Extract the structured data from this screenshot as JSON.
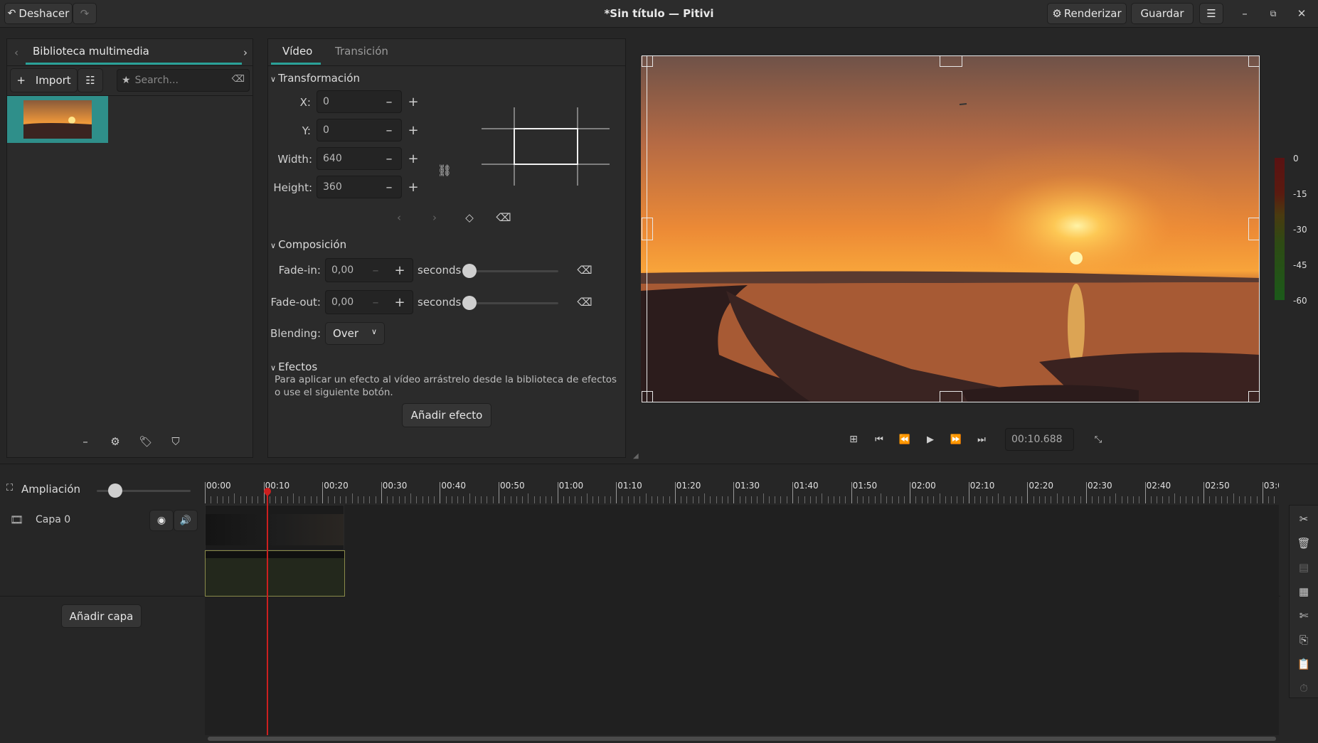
{
  "header": {
    "undo_label": "Deshacer",
    "title": "*Sin título — Pitivi",
    "render_label": "Renderizar",
    "save_label": "Guardar"
  },
  "library": {
    "tab_label": "Biblioteca multimedia",
    "import_label": "Import",
    "search_placeholder": "Search..."
  },
  "clip_props": {
    "tabs": [
      "Vídeo",
      "Transición"
    ],
    "transform": {
      "heading": "Transformación",
      "x_label": "X:",
      "x_value": "0",
      "y_label": "Y:",
      "y_value": "0",
      "width_label": "Width:",
      "width_value": "640",
      "height_label": "Height:",
      "height_value": "360"
    },
    "composition": {
      "heading": "Composición",
      "fadein_label": "Fade-in:",
      "fadein_value": "0,00",
      "fadeout_label": "Fade-out:",
      "fadeout_value": "0,00",
      "seconds_label": "seconds",
      "blending_label": "Blending:",
      "blending_value": "Over"
    },
    "effects": {
      "heading": "Efectos",
      "hint": "Para aplicar un efecto al vídeo arrástrelo desde la biblioteca de efectos o use el siguiente botón.",
      "add_label": "Añadir efecto"
    }
  },
  "viewer": {
    "timecode": "00:10.688",
    "meter_labels": [
      "0",
      "-15",
      "-30",
      "-45",
      "-60"
    ]
  },
  "timeline": {
    "zoom_label": "Ampliación",
    "layer_name": "Capa 0",
    "add_layer_label": "Añadir capa",
    "ruler_labels": [
      "00:00",
      "00:10",
      "00:20",
      "00:30",
      "00:40",
      "00:50",
      "01:00",
      "01:10",
      "01:20",
      "01:30",
      "01:40",
      "01:50",
      "02:00",
      "02:10",
      "02:20",
      "02:30",
      "02:40",
      "02:50",
      "03:0"
    ]
  },
  "colors": {
    "accent": "#2aa198",
    "playhead": "#cc1f1f",
    "thumb_bg": "#2f8f8a"
  }
}
